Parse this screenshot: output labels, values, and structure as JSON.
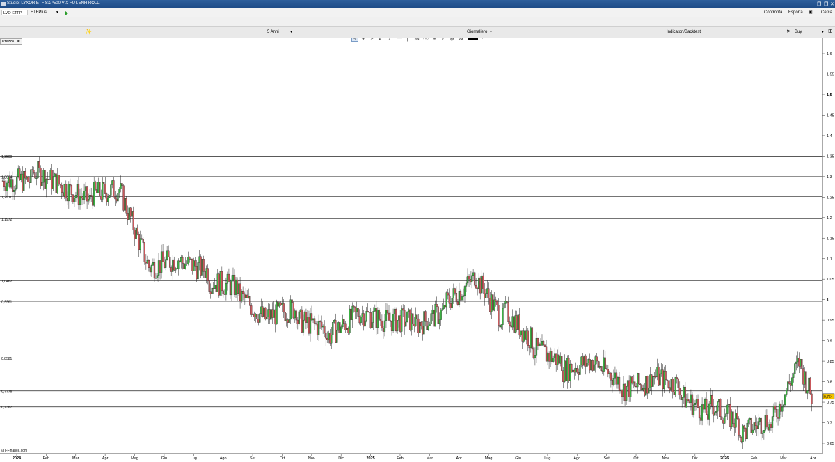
{
  "window": {
    "title": "Studio: LYXOR ETF S&P500 VIX FUT.ENH ROLL"
  },
  "topbar": {
    "symbol": "LVO-ETFP",
    "product": "ETFPlus",
    "compare": "Confronta",
    "export": "Esporta",
    "search": "Cerca"
  },
  "toolbar": {
    "icons": [
      "pointer-icon",
      "crosshair-icon",
      "zoom-icon",
      "trendline-icon",
      "line-icon",
      "horizontal-line-icon",
      "vertical-line-icon",
      "channel-icon",
      "text-icon",
      "fibonacci-icon",
      "parallel-icon",
      "eraser-icon",
      "trash-icon",
      "magnet-icon",
      "color-picker-icon"
    ],
    "line_color": "#000000"
  },
  "settings": {
    "period": "5 Anni",
    "interval": "Giornaliero",
    "indicators": "Indicatori/Backtest",
    "signal": "Buy"
  },
  "chart": {
    "panel_label": "Prezzo",
    "copyright": "©IT-Finance.com",
    "last_price": "0,764",
    "up_color": "#3cb043",
    "down_color": "#c9585c"
  },
  "chart_data": {
    "type": "candlestick",
    "title": "",
    "y_ticks": [
      "1,6",
      "1,55",
      "1,5",
      "1,45",
      "1,4",
      "1,35",
      "1,3",
      "1,25",
      "1,2",
      "1,15",
      "1,1",
      "1,05",
      "1",
      "0,95",
      "0,9",
      "0,85",
      "0,8",
      "0,75",
      "0,7",
      "0,65"
    ],
    "x_ticks": [
      "2024",
      "Feb",
      "Mar",
      "Apr",
      "Mag",
      "Giu",
      "Lug",
      "Ago",
      "Set",
      "Ott",
      "Nov",
      "Dic",
      "2025",
      "Feb",
      "Mar",
      "Apr",
      "Mag",
      "Giu",
      "Lug",
      "Ago",
      "Set",
      "Ott",
      "Nov",
      "Dic",
      "2026",
      "Feb",
      "Mar",
      "Apr"
    ],
    "horizontal_levels": [
      {
        "value": 1.35,
        "label": "1,3500"
      },
      {
        "value": 1.3,
        "label": "1,3004"
      },
      {
        "value": 1.2511,
        "label": "1,2511"
      },
      {
        "value": 1.1972,
        "label": "1,1972"
      },
      {
        "value": 1.0462,
        "label": "1,0462"
      },
      {
        "value": 0.9961,
        "label": "0,9961"
      },
      {
        "value": 0.8581,
        "label": "0,8581"
      },
      {
        "value": 0.7776,
        "label": "0,7776"
      },
      {
        "value": 0.7387,
        "label": "0,7387"
      }
    ],
    "monthly_close": [
      {
        "month": "2024-01",
        "close": 1.29
      },
      {
        "month": "2024-02",
        "close": 1.28
      },
      {
        "month": "2024-03",
        "close": 1.24
      },
      {
        "month": "2024-04",
        "close": 1.27
      },
      {
        "month": "2024-05",
        "close": 1.08
      },
      {
        "month": "2024-06",
        "close": 1.1
      },
      {
        "month": "2024-07",
        "close": 1.07
      },
      {
        "month": "2024-08",
        "close": 1.03
      },
      {
        "month": "2024-09",
        "close": 0.95
      },
      {
        "month": "2024-10",
        "close": 0.98
      },
      {
        "month": "2024-11",
        "close": 0.93
      },
      {
        "month": "2024-12",
        "close": 0.96
      },
      {
        "month": "2025-01",
        "close": 0.95
      },
      {
        "month": "2025-02",
        "close": 0.95
      },
      {
        "month": "2025-03",
        "close": 0.97
      },
      {
        "month": "2025-04",
        "close": 1.05
      },
      {
        "month": "2025-05",
        "close": 0.95
      },
      {
        "month": "2025-06",
        "close": 0.9
      },
      {
        "month": "2025-07",
        "close": 0.85
      },
      {
        "month": "2025-08",
        "close": 0.85
      },
      {
        "month": "2025-09",
        "close": 0.8
      },
      {
        "month": "2025-10",
        "close": 0.8
      },
      {
        "month": "2025-11",
        "close": 0.79
      },
      {
        "month": "2025-12",
        "close": 0.72
      },
      {
        "month": "2026-01",
        "close": 0.7
      },
      {
        "month": "2026-02",
        "close": 0.71
      },
      {
        "month": "2026-03",
        "close": 0.84
      },
      {
        "month": "2026-04",
        "close": 0.764
      }
    ],
    "ylim": [
      0.63,
      1.62
    ],
    "grid": false
  }
}
